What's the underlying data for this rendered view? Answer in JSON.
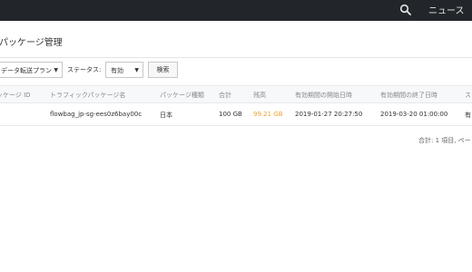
{
  "header": {
    "search_icon": "search-icon",
    "news_label": "ニュース"
  },
  "page": {
    "title": "パッケージ管理"
  },
  "filters": {
    "plan_value": "データ転送プラン",
    "status_label": "ステータス:",
    "status_value": "有効",
    "search_button": "検索"
  },
  "table": {
    "columns": [
      "ッケージ ID",
      "トラフィックパッケージ名",
      "パッケージ種類",
      "合計",
      "残高",
      "有効期間の開始日時",
      "有効期間の終了日時",
      "ス"
    ],
    "rows": [
      [
        "",
        "flowbag_jp-sg-ees0z6bay00c",
        "日本",
        "100 GB",
        "99.21 GB",
        "2019-01-27 20:27:50",
        "2019-03-20 01:00:00",
        "有"
      ]
    ]
  },
  "pagination": {
    "total_text": "合計: 1 項目,  ペー"
  },
  "colors": {
    "topbar": "#22262b",
    "remaining": "#f0a030"
  }
}
